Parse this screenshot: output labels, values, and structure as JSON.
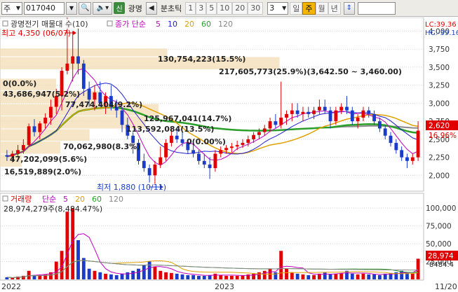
{
  "toolbar": {
    "market_code": "주",
    "stock_code": "017040",
    "new_badge": "신",
    "stock_name": "광명",
    "view_mode": "분초틱",
    "periods": [
      "1",
      "3",
      "5",
      "10",
      "20",
      "30"
    ],
    "interval_value": "3",
    "timeframes": [
      "일",
      "주",
      "월",
      "년"
    ],
    "active_timeframe": "주"
  },
  "price_panel": {
    "legend_title": "광명전기 매물대 수(10)",
    "ma_label": "종가 단순",
    "ma_periods": [
      "5",
      "10",
      "20",
      "60",
      "120"
    ],
    "ma_colors": [
      "#c000c0",
      "#2020d0",
      "#e0a000",
      "#2aa02a",
      "#888888"
    ],
    "lc_label": "LC:39.36",
    "hc_label": "HC:-39.16",
    "current_price": "2,620",
    "current_change": "16.96%",
    "high_annotation": "최고 4,350 (06/07)",
    "low_annotation": "최저 1,880 (10/11)",
    "y_ticks": [
      "4,000",
      "3,750",
      "3,500",
      "3,250",
      "3,000",
      "2,750",
      "2,500",
      "2,250",
      "2,000"
    ],
    "volume_profile": [
      {
        "label": "130,754,223(15.5%)"
      },
      {
        "label": "217,605,773(25.9%)(3,642.50 ~ 3,460.00)"
      },
      {
        "label": "0(0.0%)"
      },
      {
        "label": "43,686,947(5.2%)"
      },
      {
        "label": "77,474,404(9.2%)"
      },
      {
        "label": "125,967,041(14.7%)"
      },
      {
        "label": "113,592,084(13.5%)"
      },
      {
        "label": "70,062,980(8.3%)"
      },
      {
        "label": "47,202,099(5.6%)"
      },
      {
        "label": "16,519,889(2.0%)"
      },
      {
        "label": "0(0.00%)"
      }
    ]
  },
  "volume_panel": {
    "legend_volume": "거래량",
    "legend_ma": "단순",
    "ma_periods": [
      "5",
      "20",
      "60",
      "120"
    ],
    "ma_colors": [
      "#c000c0",
      "#e0a000",
      "#2aa02a",
      "#888888"
    ],
    "max_volume_label": "28,974,279주(8,484.47%)",
    "current_volume": "28,974",
    "current_vol_sub": "8484.4",
    "y_ticks": [
      "100,000",
      "75,000",
      "50,000",
      "25,000"
    ]
  },
  "x_axis": {
    "labels": [
      "2022",
      "2023",
      "11/20"
    ]
  },
  "chart_data": {
    "type": "candlestick",
    "y_range": [
      1800,
      4150
    ],
    "candles": [
      [
        2280,
        2350,
        2200,
        2260
      ],
      [
        2260,
        2340,
        2180,
        2300
      ],
      [
        2300,
        2420,
        2250,
        2350
      ],
      [
        2350,
        2500,
        2300,
        2420
      ],
      [
        2420,
        2720,
        2400,
        2680
      ],
      [
        2680,
        2780,
        2540,
        2600
      ],
      [
        2600,
        2750,
        2500,
        2720
      ],
      [
        2720,
        2860,
        2650,
        2800
      ],
      [
        2800,
        3050,
        2700,
        2950
      ],
      [
        2950,
        3200,
        2850,
        3100
      ],
      [
        3100,
        3500,
        2900,
        3450
      ],
      [
        3450,
        4350,
        3400,
        3550
      ],
      [
        3550,
        4000,
        3300,
        3650
      ],
      [
        3650,
        4050,
        3400,
        3550
      ],
      [
        3550,
        3600,
        3100,
        3200
      ],
      [
        3200,
        3300,
        2950,
        3050
      ],
      [
        3050,
        3250,
        2900,
        3150
      ],
      [
        3150,
        3300,
        2950,
        3000
      ],
      [
        3000,
        3150,
        2850,
        3100
      ],
      [
        3100,
        3250,
        2900,
        2950
      ],
      [
        2950,
        3050,
        2800,
        2900
      ],
      [
        2900,
        2950,
        2600,
        2700
      ],
      [
        2700,
        2800,
        2500,
        2550
      ],
      [
        2550,
        2600,
        2300,
        2450
      ],
      [
        2450,
        2500,
        2150,
        2200
      ],
      [
        2200,
        2300,
        2050,
        2100
      ],
      [
        2100,
        2150,
        1900,
        2000
      ],
      [
        2000,
        2200,
        1880,
        2150
      ],
      [
        2150,
        2400,
        2100,
        2250
      ],
      [
        2250,
        2500,
        2200,
        2450
      ],
      [
        2450,
        2650,
        2400,
        2550
      ],
      [
        2550,
        2650,
        2450,
        2500
      ],
      [
        2500,
        2600,
        2400,
        2450
      ],
      [
        2450,
        2500,
        2300,
        2350
      ],
      [
        2350,
        2450,
        2250,
        2300
      ],
      [
        2300,
        2350,
        2150,
        2200
      ],
      [
        2200,
        2300,
        2100,
        2150
      ],
      [
        2150,
        2250,
        1950,
        2100
      ],
      [
        2100,
        2350,
        2050,
        2300
      ],
      [
        2300,
        2400,
        2250,
        2350
      ],
      [
        2350,
        2420,
        2300,
        2380
      ],
      [
        2380,
        2450,
        2320,
        2400
      ],
      [
        2400,
        2480,
        2350,
        2420
      ],
      [
        2420,
        2500,
        2380,
        2450
      ],
      [
        2450,
        2550,
        2400,
        2500
      ],
      [
        2500,
        2600,
        2450,
        2560
      ],
      [
        2560,
        2650,
        2500,
        2600
      ],
      [
        2600,
        2700,
        2550,
        2650
      ],
      [
        2650,
        2800,
        2600,
        2750
      ],
      [
        2750,
        2850,
        2650,
        2700
      ],
      [
        2700,
        3300,
        2650,
        2800
      ],
      [
        2800,
        2900,
        2700,
        2850
      ],
      [
        2850,
        3000,
        2750,
        2900
      ],
      [
        2900,
        3000,
        2800,
        2850
      ],
      [
        2850,
        2950,
        2750,
        2880
      ],
      [
        2880,
        2950,
        2800,
        2850
      ],
      [
        2850,
        2950,
        2780,
        2900
      ],
      [
        2900,
        3050,
        2850,
        2950
      ],
      [
        2950,
        3050,
        2850,
        2900
      ],
      [
        2900,
        2950,
        2650,
        2750
      ],
      [
        2750,
        2950,
        2700,
        2900
      ],
      [
        2900,
        3000,
        2850,
        2950
      ],
      [
        2950,
        3100,
        2850,
        2900
      ],
      [
        2900,
        2950,
        2700,
        2750
      ],
      [
        2750,
        2850,
        2650,
        2800
      ],
      [
        2800,
        2950,
        2750,
        2900
      ],
      [
        2900,
        2950,
        2800,
        2850
      ],
      [
        2850,
        2900,
        2700,
        2750
      ],
      [
        2750,
        2800,
        2600,
        2650
      ],
      [
        2650,
        2700,
        2500,
        2550
      ],
      [
        2550,
        2600,
        2400,
        2450
      ],
      [
        2450,
        2500,
        2300,
        2350
      ],
      [
        2350,
        2400,
        2200,
        2250
      ],
      [
        2250,
        2300,
        2100,
        2200
      ],
      [
        2200,
        2300,
        2150,
        2250
      ],
      [
        2250,
        2750,
        2200,
        2620
      ]
    ],
    "volumes": [
      3,
      2,
      4,
      5,
      12,
      6,
      5,
      7,
      10,
      25,
      40,
      95,
      100,
      55,
      30,
      15,
      12,
      10,
      8,
      7,
      6,
      8,
      10,
      12,
      15,
      20,
      25,
      18,
      12,
      10,
      9,
      8,
      7,
      6,
      6,
      5,
      5,
      6,
      8,
      6,
      5,
      5,
      5,
      6,
      7,
      8,
      10,
      12,
      15,
      10,
      40,
      15,
      10,
      8,
      7,
      6,
      6,
      8,
      10,
      7,
      8,
      9,
      12,
      8,
      7,
      8,
      7,
      7,
      6,
      8,
      9,
      10,
      12,
      9,
      8,
      29
    ],
    "yvol_range": [
      0,
      110000
    ]
  }
}
